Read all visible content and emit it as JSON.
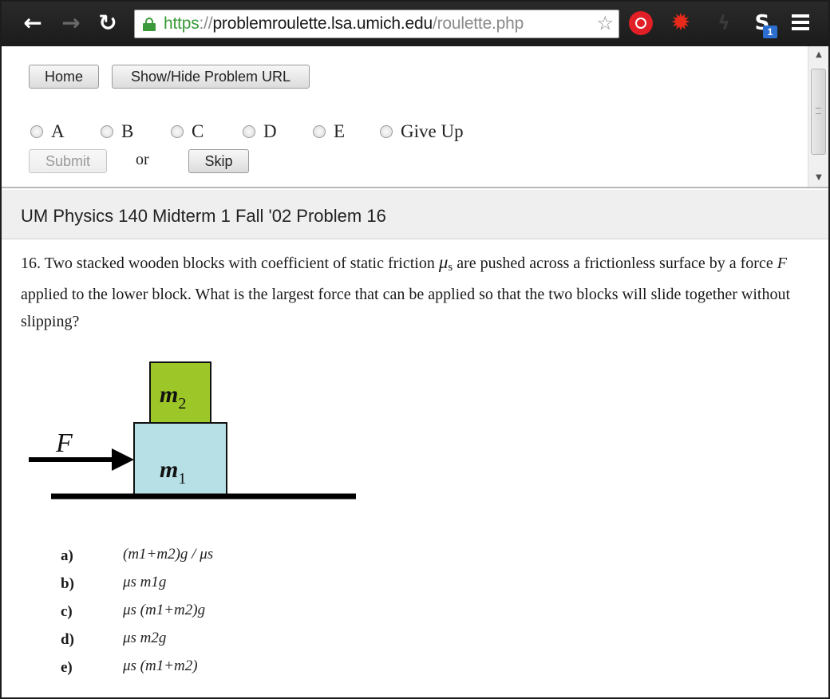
{
  "browser": {
    "url_scheme": "https",
    "url_slashes": "://",
    "url_host": "problemroulette.lsa.umich.edu",
    "url_path": "/roulette.php",
    "extension_badge": "1",
    "icons": [
      "back-icon",
      "forward-icon",
      "reload-icon",
      "lock-icon",
      "star-icon",
      "red-extension-icon",
      "burst-extension-icon",
      "bolt-extension-icon",
      "skype-icon",
      "menu-icon"
    ]
  },
  "controls": {
    "home_label": "Home",
    "toggle_url_label": "Show/Hide Problem URL",
    "choices": [
      "A",
      "B",
      "C",
      "D",
      "E",
      "Give Up"
    ],
    "submit_label": "Submit",
    "or_label": "or",
    "skip_label": "Skip"
  },
  "problem": {
    "title": "UM Physics 140 Midterm 1 Fall '02 Problem 16",
    "text_part1": "16.  Two stacked wooden blocks with coefficient of static friction ",
    "mu": "μ",
    "mu_sub": "s",
    "text_part2": " are pushed across a frictionless surface by a force ",
    "force_symbol": "F",
    "text_part3": " applied to the lower block.  What is the largest force that can be applied so that the two blocks will slide together without slipping?",
    "figure": {
      "force_label": "F",
      "upper_block_label": "m",
      "upper_block_sub": "2",
      "lower_block_label": "m",
      "lower_block_sub": "1",
      "upper_block_color": "#9dc628",
      "lower_block_color": "#b7e0e6"
    },
    "answers": [
      {
        "letter": "a)",
        "expr": "(m1+m2)g / μs"
      },
      {
        "letter": "b)",
        "expr": "μs m1g"
      },
      {
        "letter": "c)",
        "expr": "μs (m1+m2)g"
      },
      {
        "letter": "d)",
        "expr": "μs m2g"
      },
      {
        "letter": "e)",
        "expr": "μs (m1+m2)"
      }
    ]
  }
}
